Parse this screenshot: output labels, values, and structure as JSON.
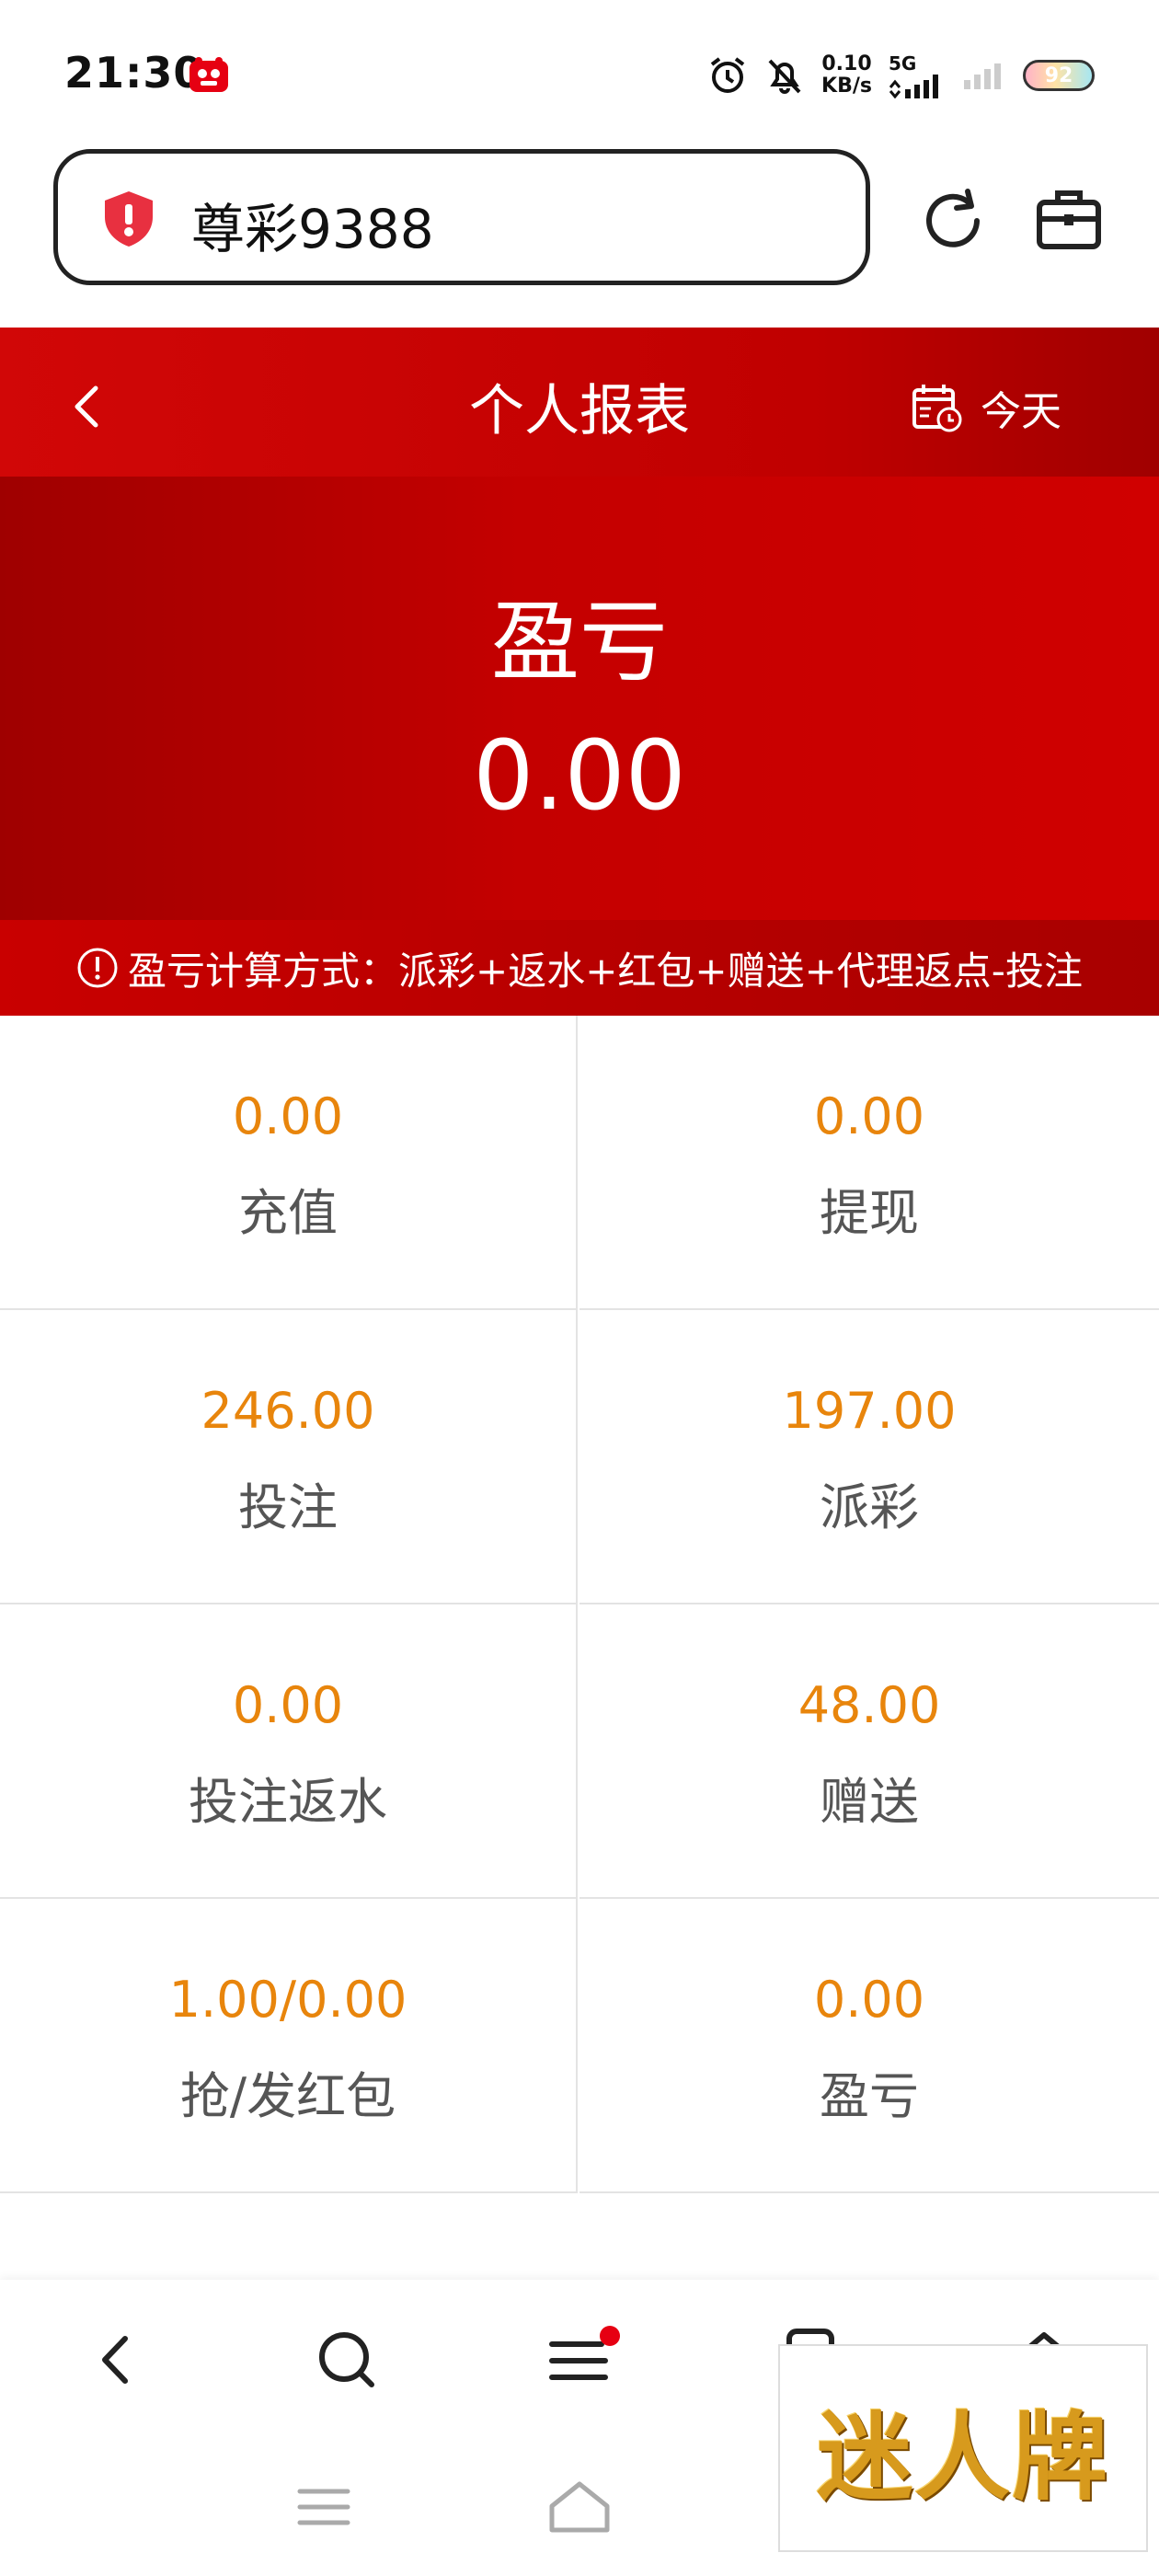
{
  "status_bar": {
    "time": "21:30",
    "net_speed_value": "0.10",
    "net_speed_unit": "KB/s",
    "network": "5G",
    "battery": "92"
  },
  "browser": {
    "url_text": "尊彩9388",
    "icons": [
      "shield-icon",
      "reload-icon",
      "toolbox-icon"
    ]
  },
  "header": {
    "title": "个人报表",
    "date_filter": "今天"
  },
  "hero": {
    "label": "盈亏",
    "value": "0.00"
  },
  "formula": {
    "text": "盈亏计算方式：派彩+返水+红包+赠送+代理返点-投注"
  },
  "stats": [
    {
      "value": "0.00",
      "label": "充值"
    },
    {
      "value": "0.00",
      "label": "提现"
    },
    {
      "value": "246.00",
      "label": "投注"
    },
    {
      "value": "197.00",
      "label": "派彩"
    },
    {
      "value": "0.00",
      "label": "投注返水"
    },
    {
      "value": "48.00",
      "label": "赠送"
    },
    {
      "value": "1.00/0.00",
      "label": "抢/发红包"
    },
    {
      "value": "0.00",
      "label": "盈亏"
    }
  ],
  "colors": {
    "header_red": "#c00000",
    "value_orange": "#e8850c",
    "label_gray": "#555555"
  },
  "watermark": {
    "text": "迷人牌"
  }
}
